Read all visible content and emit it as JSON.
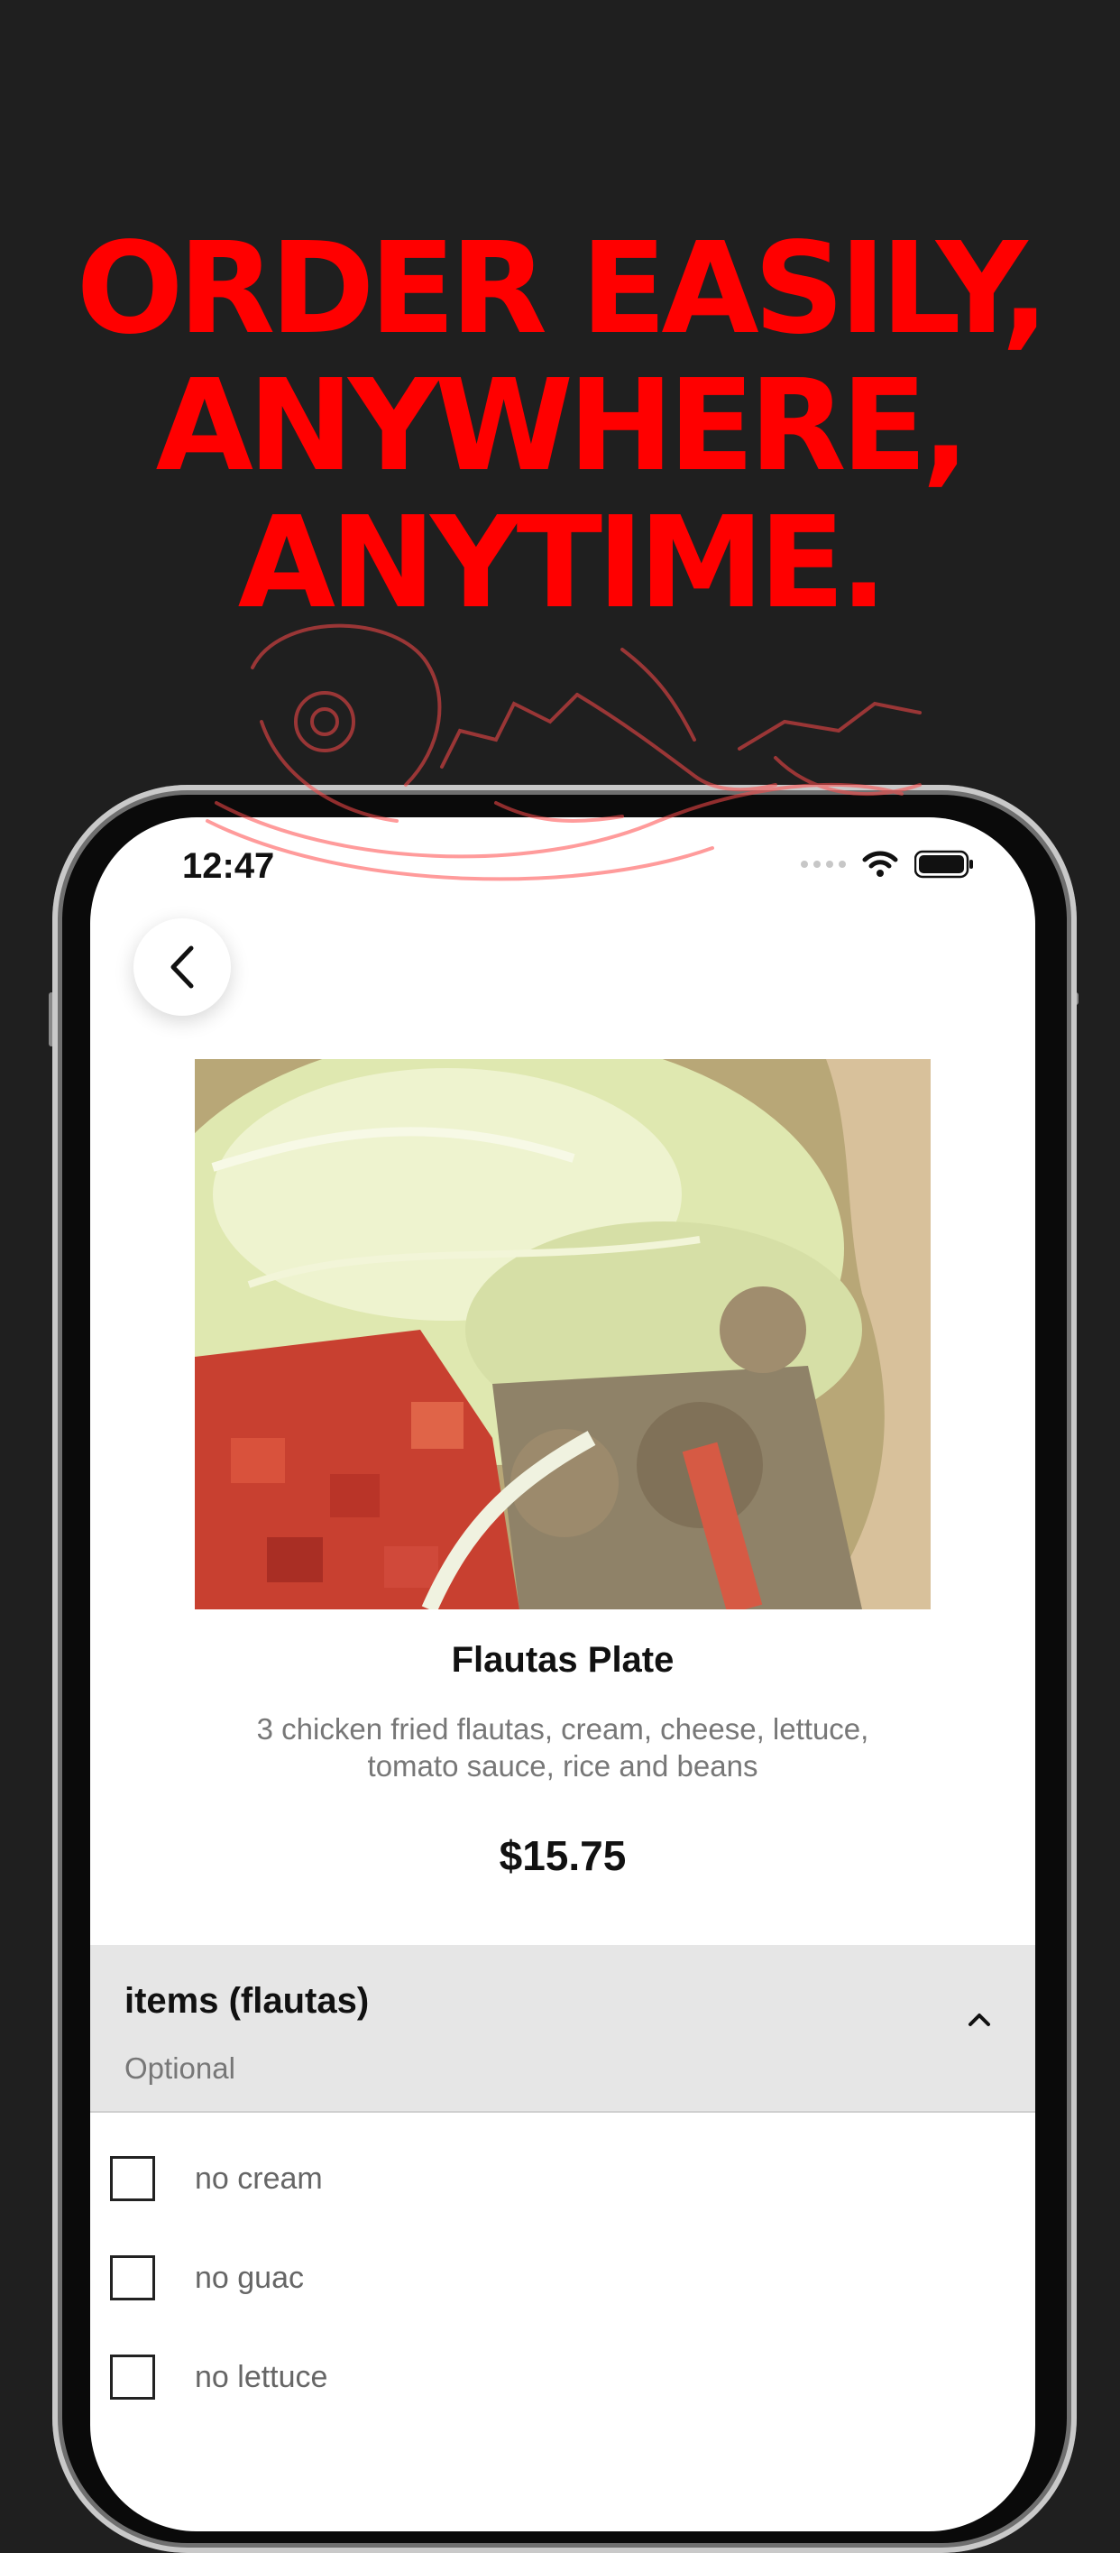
{
  "promo": {
    "headline_lines": [
      "ORDER EASILY,",
      "ANYWHERE,",
      "ANYTIME."
    ]
  },
  "status_bar": {
    "time": "12:47"
  },
  "item": {
    "title": "Flautas Plate",
    "description": "3 chicken fried flautas, cream, cheese, lettuce, tomato sauce, rice and beans",
    "price": "$15.75"
  },
  "modifier_group": {
    "title": "items (flautas)",
    "subtitle": "Optional",
    "expanded": true,
    "options": [
      {
        "label": "no cream",
        "checked": false
      },
      {
        "label": "no guac",
        "checked": false
      },
      {
        "label": "no lettuce",
        "checked": false
      }
    ]
  },
  "icons": {
    "back": "chevron-left-icon",
    "collapse": "chevron-up-icon",
    "wifi": "wifi-icon",
    "battery": "battery-icon"
  },
  "colors": {
    "headline": "#ff0000",
    "background": "#1f1f1f",
    "section_header_bg": "#e6e6e6"
  }
}
